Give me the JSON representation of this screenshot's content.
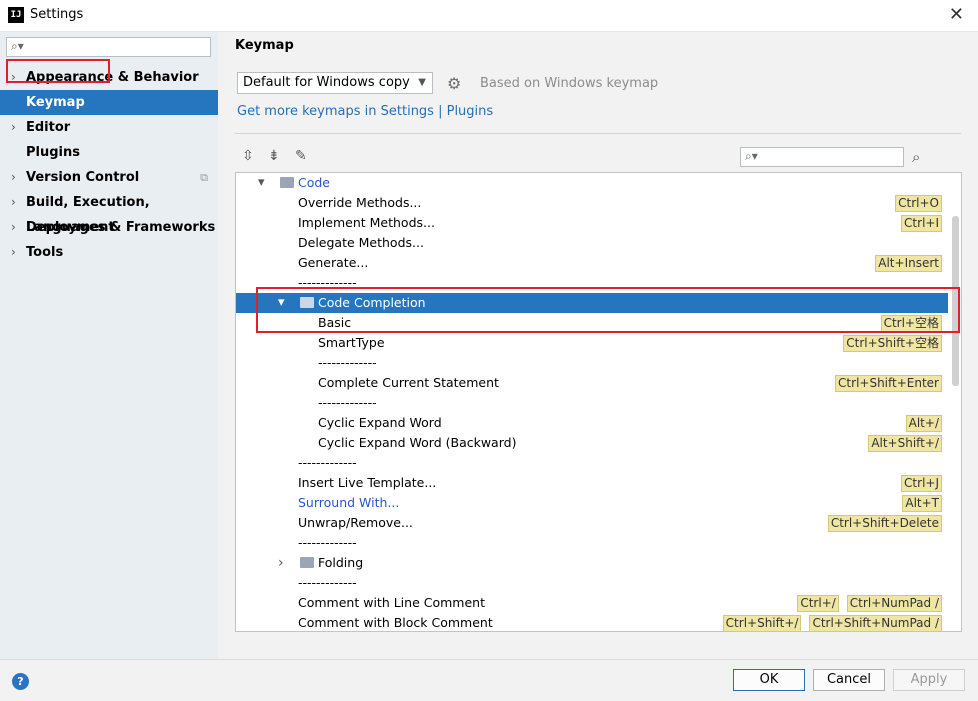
{
  "window": {
    "title": "Settings",
    "app_icon_text": "IJ"
  },
  "sidebar": {
    "items": [
      {
        "label": "Appearance & Behavior",
        "expandable": true
      },
      {
        "label": "Keymap",
        "expandable": false,
        "selected": true
      },
      {
        "label": "Editor",
        "expandable": true
      },
      {
        "label": "Plugins",
        "expandable": false
      },
      {
        "label": "Version Control",
        "expandable": true
      },
      {
        "label": "Build, Execution, Deployment",
        "expandable": true
      },
      {
        "label": "Languages & Frameworks",
        "expandable": true
      },
      {
        "label": "Tools",
        "expandable": true
      }
    ]
  },
  "main": {
    "title": "Keymap",
    "scheme": "Default for Windows copy",
    "based_on": "Based on Windows keymap",
    "keymaps_link": "Get more keymaps in Settings | Plugins"
  },
  "tree": {
    "rows": [
      {
        "level": 0,
        "type": "folder",
        "label": "Code",
        "expanded": true,
        "link": true,
        "shortcuts": []
      },
      {
        "level": 1,
        "label": "Override Methods...",
        "shortcuts": [
          "Ctrl+O"
        ]
      },
      {
        "level": 1,
        "label": "Implement Methods...",
        "shortcuts": [
          "Ctrl+I"
        ]
      },
      {
        "level": 1,
        "label": "Delegate Methods...",
        "shortcuts": []
      },
      {
        "level": 1,
        "label": "Generate...",
        "shortcuts": [
          "Alt+Insert"
        ]
      },
      {
        "level": 1,
        "label": "-------------",
        "shortcuts": []
      },
      {
        "level": 1,
        "type": "folder",
        "label": "Code Completion",
        "expanded": true,
        "selected": true,
        "shortcuts": []
      },
      {
        "level": 2,
        "label": "Basic",
        "shortcuts": [
          "Ctrl+空格"
        ]
      },
      {
        "level": 2,
        "label": "SmartType",
        "shortcuts": [
          "Ctrl+Shift+空格"
        ]
      },
      {
        "level": 2,
        "label": "-------------",
        "shortcuts": []
      },
      {
        "level": 2,
        "label": "Complete Current Statement",
        "shortcuts": [
          "Ctrl+Shift+Enter"
        ]
      },
      {
        "level": 2,
        "label": "-------------",
        "shortcuts": []
      },
      {
        "level": 2,
        "label": "Cyclic Expand Word",
        "shortcuts": [
          "Alt+/"
        ]
      },
      {
        "level": 2,
        "label": "Cyclic Expand Word (Backward)",
        "shortcuts": [
          "Alt+Shift+/"
        ]
      },
      {
        "level": 1,
        "label": "-------------",
        "shortcuts": []
      },
      {
        "level": 1,
        "label": "Insert Live Template...",
        "shortcuts": [
          "Ctrl+J"
        ]
      },
      {
        "level": 1,
        "label": "Surround With...",
        "link": true,
        "shortcuts": [
          "Alt+T"
        ]
      },
      {
        "level": 1,
        "label": "Unwrap/Remove...",
        "shortcuts": [
          "Ctrl+Shift+Delete"
        ]
      },
      {
        "level": 1,
        "label": "-------------",
        "shortcuts": []
      },
      {
        "level": 1,
        "type": "folder",
        "label": "Folding",
        "expanded": false,
        "shortcuts": []
      },
      {
        "level": 1,
        "label": "-------------",
        "shortcuts": []
      },
      {
        "level": 1,
        "label": "Comment with Line Comment",
        "shortcuts": [
          "Ctrl+/",
          "Ctrl+NumPad /"
        ]
      },
      {
        "level": 1,
        "label": "Comment with Block Comment",
        "shortcuts": [
          "Ctrl+Shift+/",
          "Ctrl+Shift+NumPad /"
        ]
      }
    ]
  },
  "footer": {
    "ok": "OK",
    "cancel": "Cancel",
    "apply": "Apply",
    "help": "?"
  },
  "colors": {
    "accent": "#2675bf",
    "link": "#2470b3",
    "shortcut_bg": "#f0e6a4",
    "highlight_box": "#e0202a"
  },
  "icons": [
    "search-icon",
    "gear-icon",
    "expand-all-icon",
    "collapse-all-icon",
    "edit-icon",
    "find-shortcut-icon",
    "folder-icon",
    "help-icon",
    "close-icon"
  ]
}
